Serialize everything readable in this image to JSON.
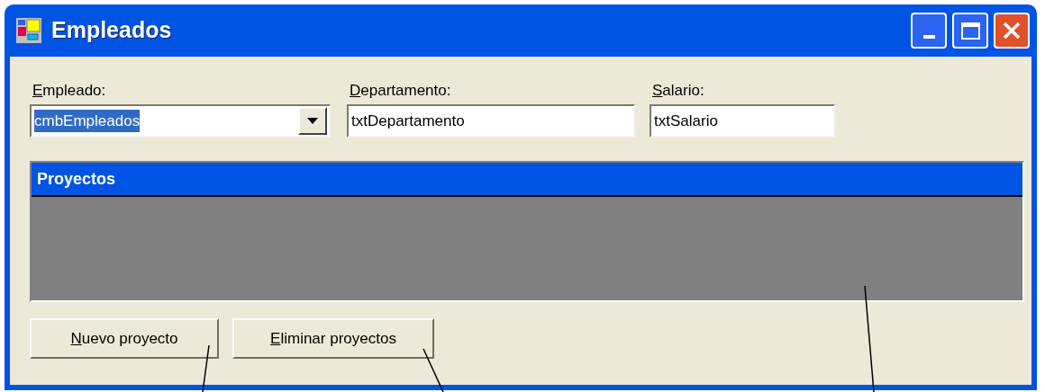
{
  "window": {
    "title": "Empleados"
  },
  "fields": [
    {
      "kind": "combo",
      "label": "Empleado:",
      "mnemonic": true,
      "value": "cmbEmpleados",
      "selected": true
    },
    {
      "kind": "text",
      "label": "Departamento:",
      "mnemonic": true,
      "value": "txtDepartamento",
      "selected": false
    },
    {
      "kind": "text",
      "label": "Salario:",
      "mnemonic": true,
      "value": "txtSalario",
      "selected": false
    }
  ],
  "grid": {
    "caption": "Proyectos"
  },
  "buttons": [
    {
      "label": "Nuevo proyecto",
      "mnemonic": true
    },
    {
      "label": "Eliminar proyectos",
      "mnemonic": true
    }
  ]
}
